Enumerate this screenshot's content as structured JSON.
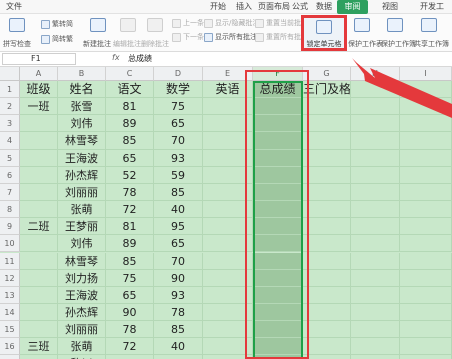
{
  "menu": {
    "file": "文件",
    "tabs": [
      "开始",
      "插入",
      "页面布局",
      "公式",
      "数据",
      "审阅",
      "视图",
      "开发工"
    ],
    "active_tab": "审阅"
  },
  "ribbon": {
    "spellcheck": "拼写检查",
    "trad_to_simp": "繁转简",
    "simp_to_trad": "简转繁",
    "new_comment": "新建批注",
    "edit_comment": "编辑批注",
    "delete_comment": "删除批注",
    "prev": "上一条",
    "next": "下一条",
    "show_hide_comment": "显示/隐藏批注",
    "show_all_comments": "显示所有批注",
    "reset_current_shape": "重置当前批",
    "reset_all_shapes": "重置所有批",
    "lock_cell": "锁定单元格",
    "protect_sheet": "保护工作表",
    "protect_workbook": "保护工作簿",
    "share_workbook": "共享工作簿"
  },
  "formula_bar": {
    "cell_ref": "F1",
    "fx": "fx",
    "value": "总成绩"
  },
  "columns": [
    "A",
    "B",
    "C",
    "D",
    "E",
    "F",
    "G",
    "H",
    "I"
  ],
  "selected_column": "F",
  "rows": [
    {
      "n": "1",
      "A": "班级",
      "B": "姓名",
      "C": "语文",
      "D": "数学",
      "E": "英语",
      "F": "总成绩",
      "G": "三门及格"
    },
    {
      "n": "2",
      "A": "一班",
      "B": "张雪",
      "C": "81",
      "D": "75",
      "E": "",
      "F": "",
      "G": ""
    },
    {
      "n": "3",
      "A": "",
      "B": "刘伟",
      "C": "89",
      "D": "65",
      "E": "",
      "F": "",
      "G": ""
    },
    {
      "n": "4",
      "A": "",
      "B": "林雪琴",
      "C": "85",
      "D": "70",
      "E": "",
      "F": "",
      "G": ""
    },
    {
      "n": "5",
      "A": "",
      "B": "王海波",
      "C": "65",
      "D": "93",
      "E": "",
      "F": "",
      "G": ""
    },
    {
      "n": "6",
      "A": "",
      "B": "孙杰辉",
      "C": "52",
      "D": "59",
      "E": "",
      "F": "",
      "G": ""
    },
    {
      "n": "7",
      "A": "",
      "B": "刘丽丽",
      "C": "78",
      "D": "85",
      "E": "",
      "F": "",
      "G": ""
    },
    {
      "n": "8",
      "A": "",
      "B": "张萌",
      "C": "72",
      "D": "40",
      "E": "",
      "F": "",
      "G": ""
    },
    {
      "n": "9",
      "A": "二班",
      "B": "王梦丽",
      "C": "81",
      "D": "95",
      "E": "",
      "F": "",
      "G": ""
    },
    {
      "n": "10",
      "A": "",
      "B": "刘伟",
      "C": "89",
      "D": "65",
      "E": "",
      "F": "",
      "G": ""
    },
    {
      "n": "11",
      "A": "",
      "B": "林雪琴",
      "C": "85",
      "D": "70",
      "E": "",
      "F": "",
      "G": ""
    },
    {
      "n": "12",
      "A": "",
      "B": "刘力扬",
      "C": "75",
      "D": "90",
      "E": "",
      "F": "",
      "G": ""
    },
    {
      "n": "13",
      "A": "",
      "B": "王海波",
      "C": "65",
      "D": "93",
      "E": "",
      "F": "",
      "G": ""
    },
    {
      "n": "14",
      "A": "",
      "B": "孙杰辉",
      "C": "90",
      "D": "78",
      "E": "",
      "F": "",
      "G": ""
    },
    {
      "n": "15",
      "A": "",
      "B": "刘丽丽",
      "C": "78",
      "D": "85",
      "E": "",
      "F": "",
      "G": ""
    },
    {
      "n": "16",
      "A": "三班",
      "B": "张萌",
      "C": "72",
      "D": "40",
      "E": "",
      "F": "",
      "G": ""
    },
    {
      "n": "17",
      "A": "",
      "B": "黎川",
      "C": "90",
      "D": "65",
      "E": "",
      "F": "",
      "G": ""
    }
  ],
  "colors": {
    "accent_green": "#2ea05f",
    "sheet_bg": "#c9e8cb",
    "selected_column_fill": "#9ec79f",
    "highlight_red": "#e4393c"
  }
}
